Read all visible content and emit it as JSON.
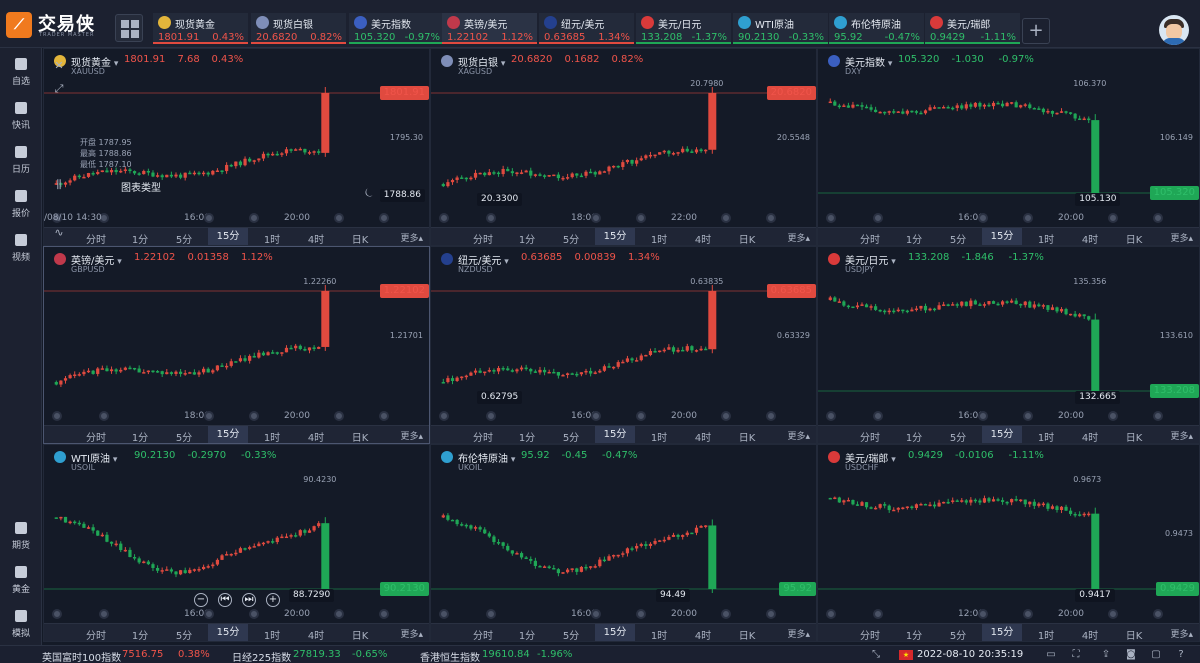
{
  "app": {
    "name": "交易侠",
    "subtitle": "TRADER MASTER"
  },
  "tickers": [
    {
      "name": "现货黄金",
      "price": "1801.91",
      "change": "0.43%",
      "dir": "up",
      "flag_color": "#e2b53b"
    },
    {
      "name": "现货白银",
      "price": "20.6820",
      "change": "0.82%",
      "dir": "up",
      "flag_color": "#7f8eb8"
    },
    {
      "name": "美元指数",
      "price": "105.320",
      "change": "-0.97%",
      "dir": "down",
      "flag_color": "#3b5fc0"
    },
    {
      "name": "英镑/美元",
      "price": "1.22102",
      "change": "1.12%",
      "dir": "up",
      "flag_color": "#c0394b"
    },
    {
      "name": "纽元/美元",
      "price": "0.63685",
      "change": "1.34%",
      "dir": "up",
      "flag_color": "#24408e"
    },
    {
      "name": "美元/日元",
      "price": "133.208",
      "change": "-1.37%",
      "dir": "down",
      "flag_color": "#d93a3a"
    },
    {
      "name": "WTI原油",
      "price": "90.2130",
      "change": "-0.33%",
      "dir": "down",
      "flag_color": "#2f9fd0"
    },
    {
      "name": "布伦特原油",
      "price": "95.92",
      "change": "-0.47%",
      "dir": "down",
      "flag_color": "#2f9fd0"
    },
    {
      "name": "美元/瑞郎",
      "price": "0.9429",
      "change": "-1.11%",
      "dir": "down",
      "flag_color": "#d93a3a"
    }
  ],
  "sidebar": {
    "items": [
      {
        "label": "自选",
        "icon": "bookmark-icon"
      },
      {
        "label": "快讯",
        "icon": "news-icon"
      },
      {
        "label": "日历",
        "icon": "calendar-icon"
      },
      {
        "label": "报价",
        "icon": "trend-icon"
      },
      {
        "label": "视频",
        "icon": "play-icon"
      }
    ],
    "bottom_items": [
      {
        "label": "期货",
        "icon": "futures-icon"
      },
      {
        "label": "黄金",
        "icon": "gold-icon"
      },
      {
        "label": "模拟",
        "icon": "wallet-icon"
      }
    ]
  },
  "timeframes": [
    "分时",
    "1分",
    "5分",
    "15分",
    "1时",
    "4时",
    "日K"
  ],
  "timeframe_active": "15分",
  "more_label": "更多",
  "panels": [
    {
      "name": "现货黄金",
      "code": "XAUUSD",
      "price": "1801.91",
      "change": "7.68",
      "pct": "0.43%",
      "dir": "up",
      "flag_color": "#e2b53b",
      "last_tag": "1801.91",
      "mid_label": "1795.30",
      "low_label": "1788.86",
      "xlabels": [
        "16:00",
        "20:00"
      ],
      "ohlc": {
        "open": "开盘 1787.95",
        "high": "最高 1788.86",
        "low": "最低 1787.10"
      },
      "chart_type_label": "图表类型",
      "crosshair_time": "/08/10 14:30",
      "chart_data": {
        "type": "candlestick",
        "trend": "up",
        "last": 1801.91,
        "hi": 1801.91,
        "lo": 1784.5
      }
    },
    {
      "name": "现货白银",
      "code": "XAGUSD",
      "price": "20.6820",
      "change": "0.1682",
      "pct": "0.82%",
      "dir": "up",
      "flag_color": "#7f8eb8",
      "last_tag": "20.6820",
      "top_label": "20.7980",
      "mid_label": "20.5548",
      "low_label": "20.3300",
      "xlabels": [
        "18:00",
        "22:00"
      ],
      "chart_data": {
        "type": "candlestick",
        "trend": "up",
        "last": 20.682,
        "hi": 20.798,
        "lo": 20.33
      }
    },
    {
      "name": "美元指数",
      "code": "DXY",
      "price": "105.320",
      "change": "-1.030",
      "pct": "-0.97%",
      "dir": "down",
      "flag_color": "#3b5fc0",
      "last_tag": "105.320",
      "top_label": "106.370",
      "mid_label": "106.149",
      "low_label": "105.130",
      "xlabels": [
        "16:00",
        "20:00"
      ],
      "chart_data": {
        "type": "candlestick",
        "trend": "down",
        "last": 105.32,
        "hi": 106.37,
        "lo": 105.13
      }
    },
    {
      "name": "英镑/美元",
      "code": "GBPUSD",
      "price": "1.22102",
      "change": "0.01358",
      "pct": "1.12%",
      "dir": "up",
      "flag_color": "#c0394b",
      "last_tag": "1.22102",
      "top_label": "1.22260",
      "mid_label": "1.21701",
      "low_label": "",
      "xlabels": [
        "18:00",
        "20:00"
      ],
      "chart_data": {
        "type": "candlestick",
        "trend": "up",
        "last": 1.22102,
        "hi": 1.2226,
        "lo": 1.2075
      }
    },
    {
      "name": "纽元/美元",
      "code": "NZDUSD",
      "price": "0.63685",
      "change": "0.00839",
      "pct": "1.34%",
      "dir": "up",
      "flag_color": "#24408e",
      "last_tag": "0.63685",
      "top_label": "0.63835",
      "mid_label": "0.63329",
      "low_label": "0.62795",
      "xlabels": [
        "16:00",
        "20:00"
      ],
      "chart_data": {
        "type": "candlestick",
        "trend": "up",
        "last": 0.63685,
        "hi": 0.63835,
        "lo": 0.62795
      }
    },
    {
      "name": "美元/日元",
      "code": "USDJPY",
      "price": "133.208",
      "change": "-1.846",
      "pct": "-1.37%",
      "dir": "down",
      "flag_color": "#d93a3a",
      "last_tag": "133.208",
      "top_label": "135.356",
      "mid_label": "133.610",
      "low_label": "132.665",
      "xlabels": [
        "16:00",
        "20:00"
      ],
      "chart_data": {
        "type": "candlestick",
        "trend": "down",
        "last": 133.208,
        "hi": 135.356,
        "lo": 132.665
      }
    },
    {
      "name": "WTI原油",
      "code": "USOIL",
      "price": "90.2130",
      "change": "-0.2970",
      "pct": "-0.33%",
      "dir": "down",
      "flag_color": "#2f9fd0",
      "last_tag": "90.2130",
      "top_label": "90.4230",
      "mid_label": "",
      "low_label": "88.7290",
      "xlabels": [
        "16:00",
        "20:00"
      ],
      "chart_data": {
        "type": "candlestick",
        "trend": "dip",
        "last": 90.213,
        "hi": 90.423,
        "lo": 88.729
      }
    },
    {
      "name": "布伦特原油",
      "code": "UKOIL",
      "price": "95.92",
      "change": "-0.45",
      "pct": "-0.47%",
      "dir": "down",
      "flag_color": "#2f9fd0",
      "last_tag": "95.92",
      "top_label": "",
      "mid_label": "",
      "low_label": "94.49",
      "xlabels": [
        "16:00",
        "20:00"
      ],
      "chart_data": {
        "type": "candlestick",
        "trend": "dip",
        "last": 95.92,
        "hi": 96.6,
        "lo": 94.49
      }
    },
    {
      "name": "美元/瑞郎",
      "code": "USDCHF",
      "price": "0.9429",
      "change": "-0.0106",
      "pct": "-1.11%",
      "dir": "down",
      "flag_color": "#d93a3a",
      "last_tag": "0.9429",
      "top_label": "0.9673",
      "mid_label": "0.9473",
      "low_label": "0.9417",
      "xlabels": [
        "12:00",
        "20:00"
      ],
      "chart_data": {
        "type": "candlestick",
        "trend": "down",
        "last": 0.9429,
        "hi": 0.9673,
        "lo": 0.9417
      }
    }
  ],
  "statusbar": {
    "items": [
      {
        "name": "英国富时100指数",
        "value": "7516.75",
        "pct": "0.38%",
        "dir": "up"
      },
      {
        "name": "日经225指数",
        "value": "27819.33",
        "pct": "-0.65%",
        "dir": "down"
      },
      {
        "name": "香港恒生指数",
        "value": "19610.84",
        "pct": "-1.96%",
        "dir": "down"
      }
    ],
    "datetime": "2022-08-10 20:35:19"
  },
  "colors": {
    "up": "#e04a3f",
    "down": "#1fa756",
    "bg": "#141a27"
  }
}
